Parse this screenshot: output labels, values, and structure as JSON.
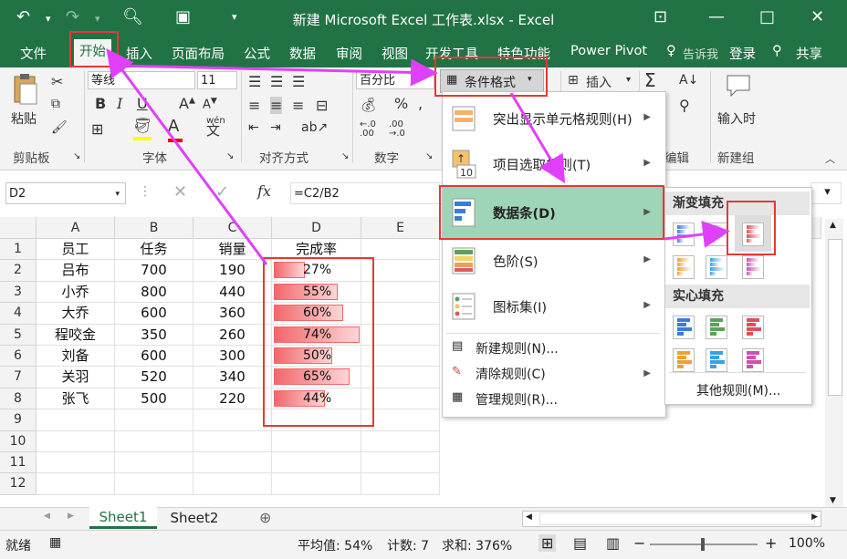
{
  "window": {
    "title": "新建 Microsoft Excel 工作表.xlsx - Excel"
  },
  "tabs": [
    {
      "label": "文件"
    },
    {
      "label": "开始"
    },
    {
      "label": "插入"
    },
    {
      "label": "页面布局"
    },
    {
      "label": "公式"
    },
    {
      "label": "数据"
    },
    {
      "label": "审阅"
    },
    {
      "label": "视图"
    },
    {
      "label": "开发工具"
    },
    {
      "label": "特色功能"
    },
    {
      "label": "Power Pivot"
    }
  ],
  "tell_me": "告诉我",
  "login": "登录",
  "share": "共享",
  "ribbon": {
    "paste": "粘贴",
    "clipboard": "剪贴板",
    "font_name": "等线",
    "font_size": "11",
    "font_group": "字体",
    "align_group": "对齐方式",
    "number_format": "百分比",
    "number_group": "数字",
    "cond_format": "条件格式",
    "insert": "插入",
    "edit_group": "编辑",
    "input_time": "输入时",
    "new_group": "新建组",
    "wen": "wén"
  },
  "formula_bar": {
    "cell_ref": "D2",
    "formula": "=C2/B2",
    "fx": "fx"
  },
  "columns": [
    "A",
    "B",
    "C",
    "D",
    "E"
  ],
  "rows": [
    "1",
    "2",
    "3",
    "4",
    "5",
    "6",
    "7",
    "8",
    "9",
    "10",
    "11",
    "12"
  ],
  "headers": [
    "员工",
    "任务",
    "销量",
    "完成率"
  ],
  "table": [
    {
      "name": "吕布",
      "task": "700",
      "sales": "190",
      "rate": "27%",
      "value": 0.27
    },
    {
      "name": "小乔",
      "task": "800",
      "sales": "440",
      "rate": "55%",
      "value": 0.55
    },
    {
      "name": "大乔",
      "task": "600",
      "sales": "360",
      "rate": "60%",
      "value": 0.6
    },
    {
      "name": "程咬金",
      "task": "350",
      "sales": "260",
      "rate": "74%",
      "value": 0.74
    },
    {
      "name": "刘备",
      "task": "600",
      "sales": "300",
      "rate": "50%",
      "value": 0.5
    },
    {
      "name": "关羽",
      "task": "520",
      "sales": "340",
      "rate": "65%",
      "value": 0.65
    },
    {
      "name": "张飞",
      "task": "500",
      "sales": "220",
      "rate": "44%",
      "value": 0.44
    }
  ],
  "menu": {
    "items": [
      {
        "label": "突出显示单元格规则(H)"
      },
      {
        "label": "项目选取规则(T)"
      },
      {
        "label": "数据条(D)"
      },
      {
        "label": "色阶(S)"
      },
      {
        "label": "图标集(I)"
      }
    ],
    "small": [
      {
        "label": "新建规则(N)..."
      },
      {
        "label": "清除规则(C)"
      },
      {
        "label": "管理规则(R)..."
      }
    ],
    "icon_text": "10"
  },
  "submenu": {
    "gradient": "渐变填充",
    "solid": "实心填充",
    "more": "其他规则(M)..."
  },
  "sheets": [
    {
      "label": "Sheet1"
    },
    {
      "label": "Sheet2"
    }
  ],
  "status": {
    "ready": "就绪",
    "avg": "平均值: 54%",
    "count": "计数: 7",
    "sum": "求和: 376%",
    "zoom": "100%"
  },
  "colors": {
    "accent": "#217346",
    "highlight": "#9fd5b7",
    "annotation": "#e040fb",
    "redbox": "#e53935"
  }
}
